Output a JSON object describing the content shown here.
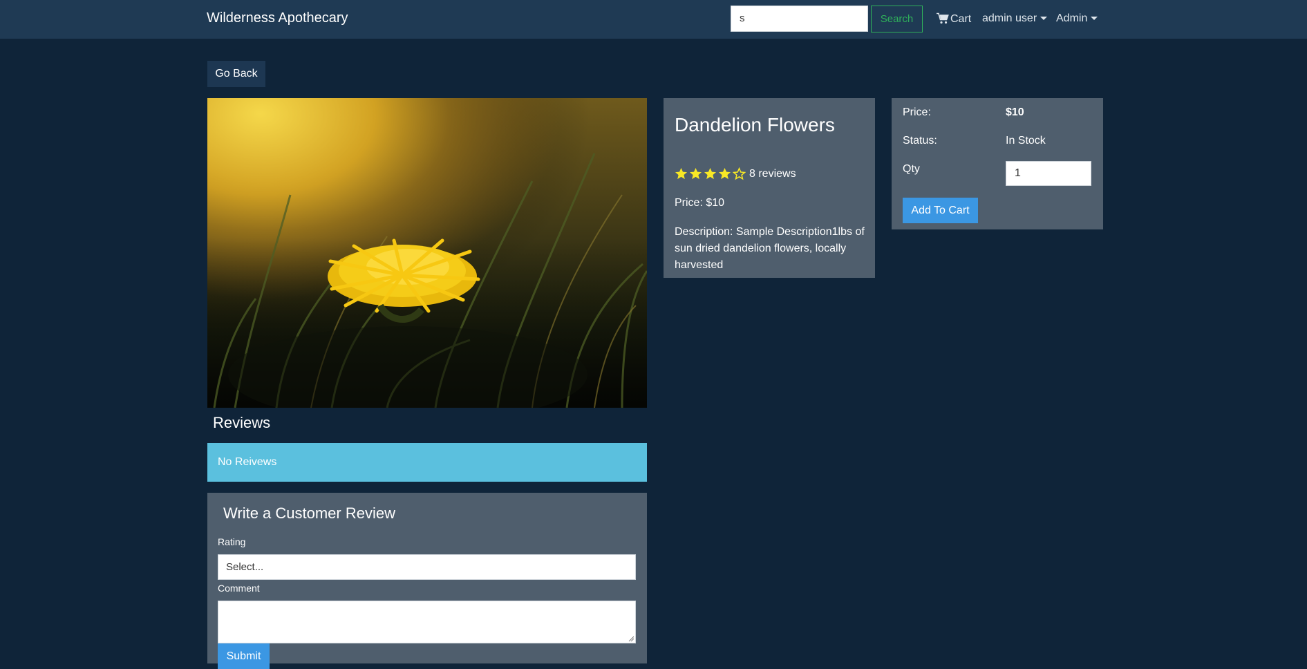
{
  "navbar": {
    "brand": "Wilderness Apothecary",
    "search_value": "s",
    "search_button": "Search",
    "cart_label": "Cart",
    "user_menu": "admin user",
    "admin_menu": "Admin",
    "cart_icon": "shopping-cart-icon"
  },
  "go_back_label": "Go Back",
  "product": {
    "image_alt": "dandelion flower in grass",
    "title": "Dandelion Flowers",
    "rating": 4,
    "rating_max": 5,
    "reviews_text": "8 reviews",
    "price_text": "Price: $10",
    "description_text": "Description: Sample Description1lbs of sun dried dandelion flowers, locally harvested"
  },
  "buy_box": {
    "price_label": "Price:",
    "price_value": "$10",
    "status_label": "Status:",
    "status_value": "In Stock",
    "qty_label": "Qty",
    "qty_value": "1",
    "add_to_cart": "Add To Cart"
  },
  "reviews": {
    "heading": "Reviews",
    "empty_message": "No Reivews"
  },
  "review_form": {
    "title": "Write a Customer Review",
    "rating_label": "Rating",
    "rating_select": "Select...",
    "comment_label": "Comment",
    "comment_value": "",
    "submit": "Submit"
  },
  "colors": {
    "page_bg": "#0f2439",
    "navbar_bg": "#1f3a54",
    "card_bg": "#4f5e6d",
    "accent_blue": "#3b97e3",
    "info_blue": "#5bc0de",
    "star_yellow": "#f8e825",
    "search_green": "#2fb05a"
  }
}
